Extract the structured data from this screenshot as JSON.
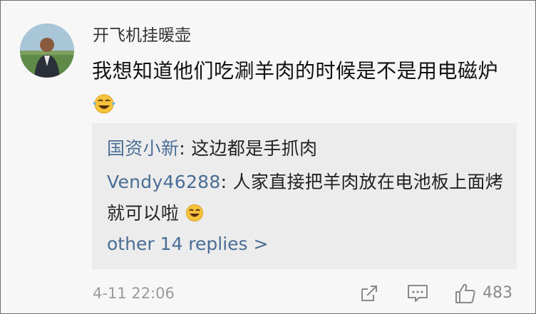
{
  "comment": {
    "username": "开飞机挂暖壶",
    "text": "我想知道他们吃涮羊肉的时候是不是用电磁炉",
    "emoji": "crying-laughing-emoji",
    "timestamp": "4-11 22:06",
    "like_count": "483"
  },
  "replies": [
    {
      "author": "国资小新",
      "separator": ": ",
      "text": "这边都是手抓肉"
    },
    {
      "author": "Vendy46288",
      "separator": ": ",
      "text": "人家直接把羊肉放在电池板上面烤就可以啦",
      "emoji": "laughing-emoji"
    }
  ],
  "more_replies_label": "other 14 replies >",
  "actions": {
    "share_icon": "share-icon",
    "comment_icon": "comment-icon",
    "like_icon": "thumbs-up-icon"
  },
  "colors": {
    "link": "#4a6d96",
    "background": "#f7f7f7",
    "reply_background": "#ececec",
    "meta": "#9a9a9a"
  }
}
